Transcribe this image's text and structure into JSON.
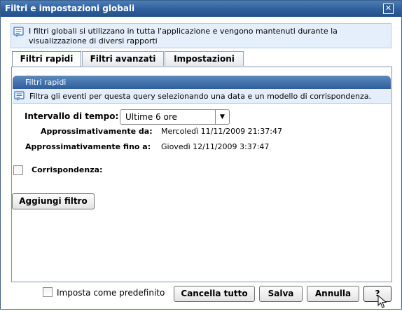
{
  "dialog": {
    "title": "Filtri e impostazioni globali",
    "close_glyph": "✕"
  },
  "info": {
    "icon": "note-icon",
    "text": "I filtri globali si utilizzano in tutta l'applicazione e vengono mantenuti durante la visualizzazione di diversi rapporti"
  },
  "tabs": [
    {
      "label": "Filtri rapidi",
      "active": true
    },
    {
      "label": "Filtri avanzati",
      "active": false
    },
    {
      "label": "Impostazioni",
      "active": false
    }
  ],
  "section": {
    "header": "Filtri rapidi",
    "description": "Filtra gli eventi per questa query selezionando una data e un modello di corrispondenza."
  },
  "form": {
    "interval_label": "Intervallo di tempo:",
    "interval_value": "Ultime 6 ore",
    "from_label": "Approssimativamente da:",
    "from_value": "Mercoledì 11/11/2009 21:37:47",
    "to_label": "Approssimativamente fino a:",
    "to_value": "Giovedì 12/11/2009 3:37:47",
    "match_label": "Corrispondenza:",
    "match_checked": false
  },
  "add_filter_label": "Aggiungi filtro",
  "footer": {
    "default_label": "Imposta come predefinito",
    "default_checked": false,
    "clear_all_label": "Cancella tutto",
    "save_label": "Salva",
    "cancel_label": "Annulla",
    "help_label": "?"
  },
  "colors": {
    "titlebar": "#2e5e99",
    "info_bg": "#e4effb",
    "section_header": "#3b6aa8"
  }
}
